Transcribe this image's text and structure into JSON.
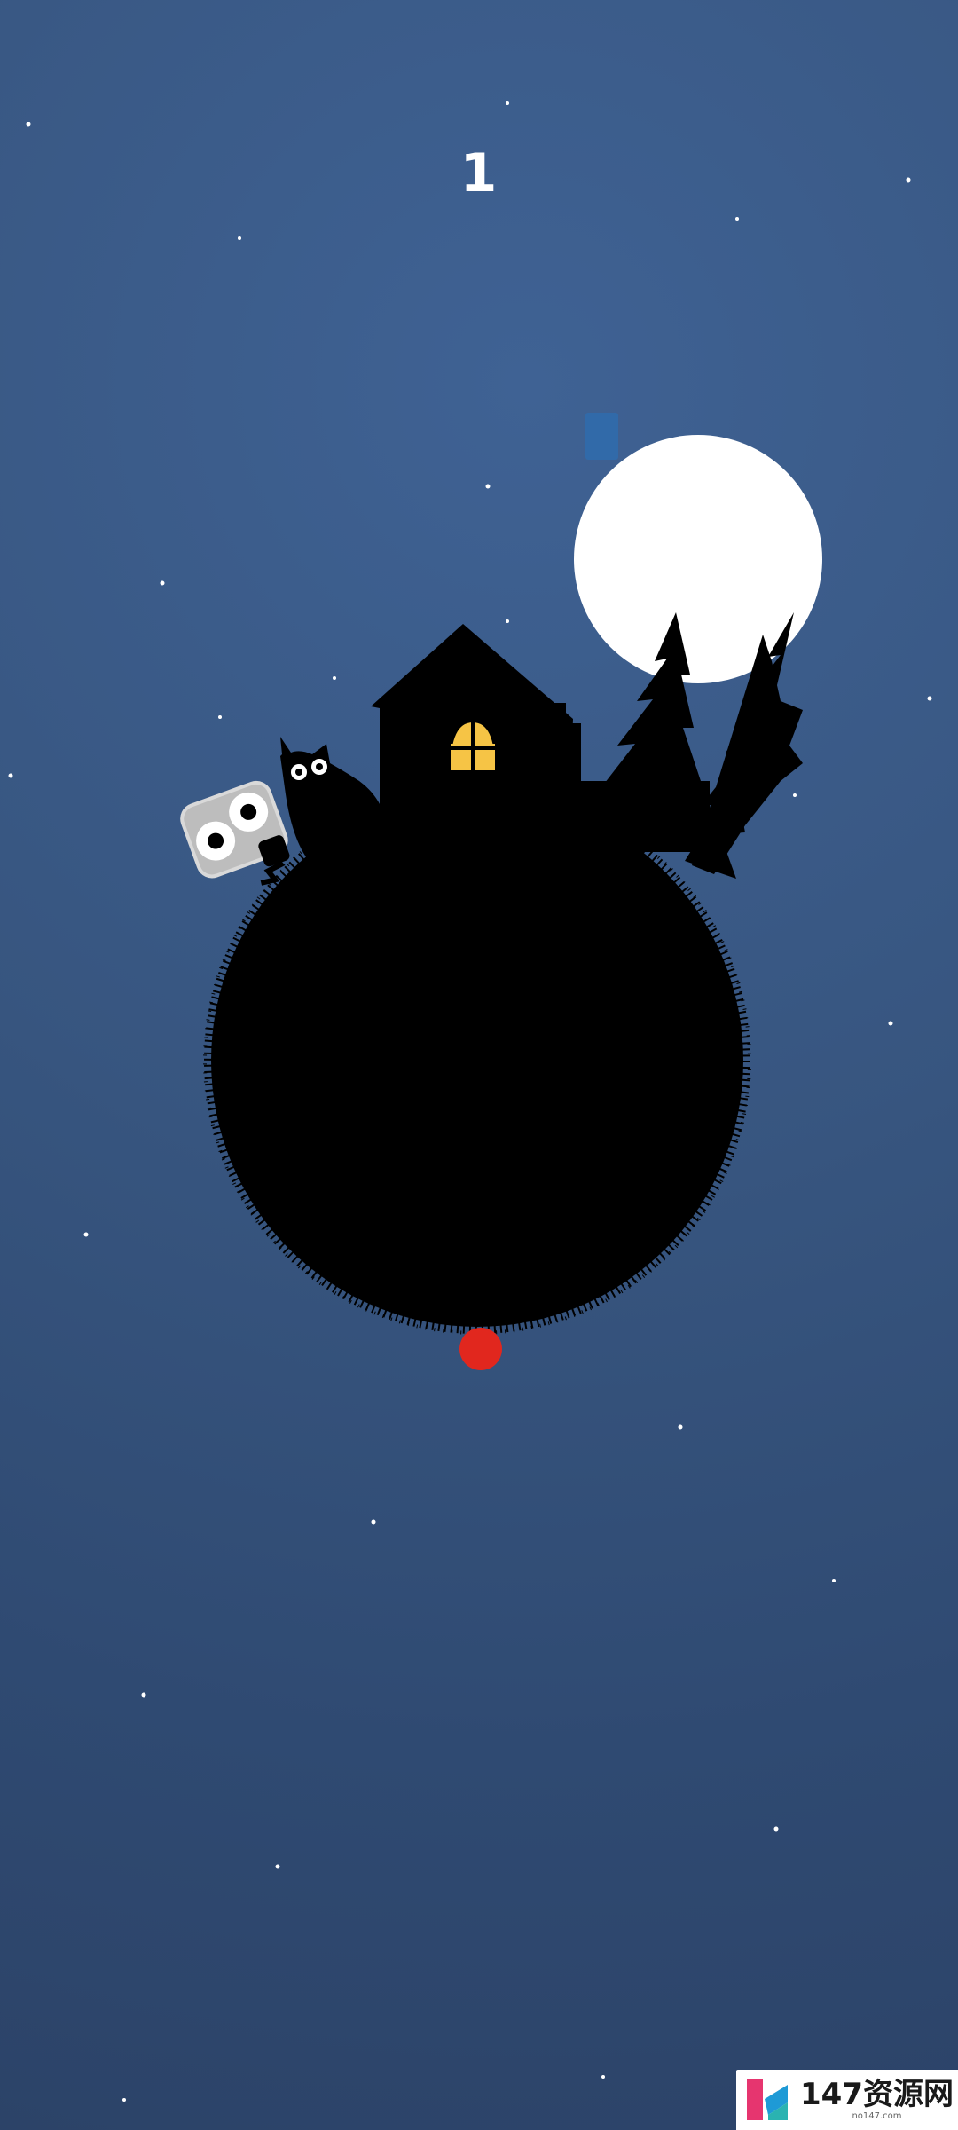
{
  "hud": {
    "score": "1"
  },
  "scene": {
    "background_color": "#355784",
    "planet_color": "#000000",
    "moon_color": "#ffffff",
    "window_light_color": "#f6c445",
    "ball_color": "#e1271e",
    "owl_body_color": "#bdbdbd",
    "small_block_color": "#2f6cad"
  },
  "watermark": {
    "main_text": "147资源网",
    "sub_text": "no147.com"
  }
}
